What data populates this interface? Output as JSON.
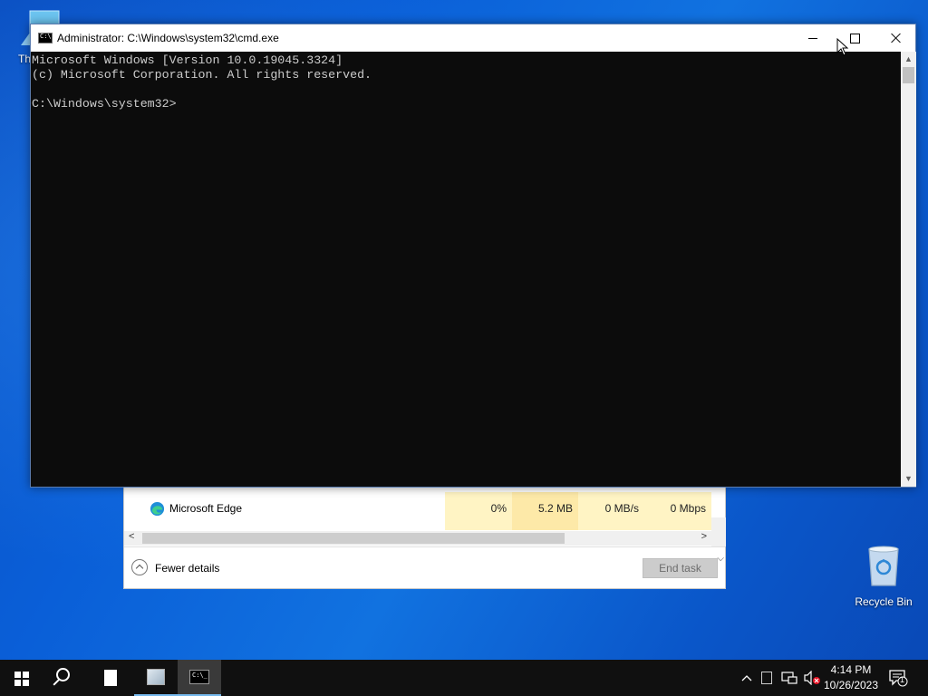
{
  "desktop": {
    "icons": {
      "this_pc": "Th",
      "recycle_bin": "Recycle Bin"
    }
  },
  "task_manager": {
    "rows": [
      {
        "name": "Microsoft Edge",
        "cpu": "0%",
        "memory": "5.2 MB",
        "disk": "0 MB/s",
        "network": "0 Mbps"
      }
    ],
    "fewer_details": "Fewer details",
    "end_task": "End task"
  },
  "cmd_window": {
    "title": "Administrator: C:\\Windows\\system32\\cmd.exe",
    "lines": [
      "Microsoft Windows [Version 10.0.19045.3324]",
      "(c) Microsoft Corporation. All rights reserved.",
      "",
      "C:\\Windows\\system32>"
    ]
  },
  "taskbar": {
    "time": "4:14 PM",
    "date": "10/26/2023",
    "notification_count": "1"
  },
  "colors": {
    "desktop_accent": "#0a5fd8",
    "console_bg": "#0c0c0c",
    "console_text": "#cccccc",
    "taskbar_bg": "#101010",
    "taskbar_active": "#76b9ed"
  }
}
